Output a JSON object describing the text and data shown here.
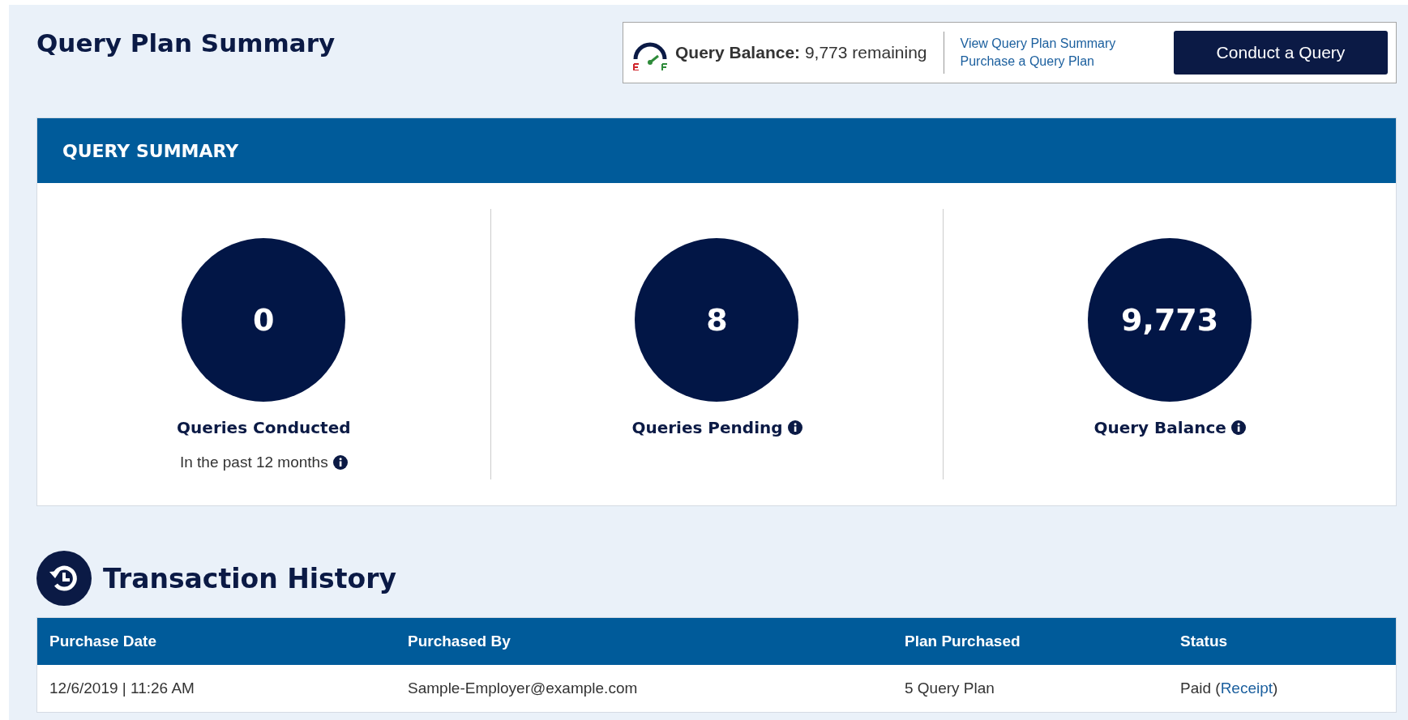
{
  "page_title": "Query Plan Summary",
  "balance_bar": {
    "label": "Query Balance:",
    "value": "9,773 remaining",
    "links": [
      "View Query Plan Summary",
      "Purchase a Query Plan"
    ],
    "button": "Conduct a Query"
  },
  "summary": {
    "title": "QUERY SUMMARY",
    "stats": [
      {
        "value": "0",
        "label": "Queries Conducted",
        "note": "In the past 12 months",
        "info": true
      },
      {
        "value": "8",
        "label": "Queries Pending",
        "info": true
      },
      {
        "value": "9,773",
        "label": "Query Balance",
        "info": true
      }
    ]
  },
  "history": {
    "title": "Transaction History",
    "columns": [
      "Purchase Date",
      "Purchased By",
      "Plan Purchased",
      "Status"
    ],
    "rows": [
      {
        "date": "12/6/2019 | 11:26 AM",
        "by": "Sample-Employer@example.com",
        "plan": "5 Query Plan",
        "status": "Paid (",
        "link": "Receipt",
        "status_end": ")"
      }
    ]
  }
}
